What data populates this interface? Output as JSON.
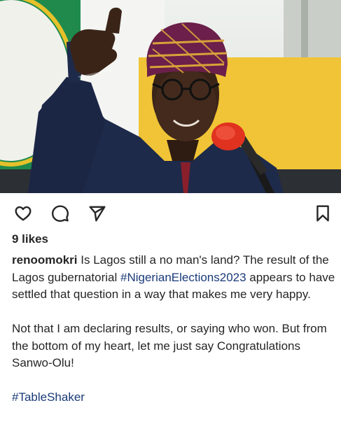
{
  "post": {
    "image_alt": "Man in patterned cap giving a thumbs up beside a red microphone",
    "likes_text": "9 likes",
    "username": "renoomokri",
    "caption_part1": " Is Lagos still a no man's land? The result of the Lagos gubernatorial ",
    "hashtag1": "#NigerianElections2023",
    "caption_part2": " appears to have settled that question in a way that makes me very happy.",
    "paragraph2": "Not that I am declaring results, or saying who won. But from the bottom of my heart, let me just say Congratulations Sanwo-Olu!",
    "hashtag2": "#TableShaker"
  },
  "icons": {
    "like": "heart-icon",
    "comment": "comment-icon",
    "share": "send-icon",
    "save": "bookmark-icon"
  },
  "colors": {
    "text": "#262626",
    "hashtag": "#1a3a7a",
    "cap_purple": "#6b1f4a",
    "cap_gold": "#d9a23a",
    "mic_red": "#e0321f",
    "agbada": "#1e2a4a"
  }
}
